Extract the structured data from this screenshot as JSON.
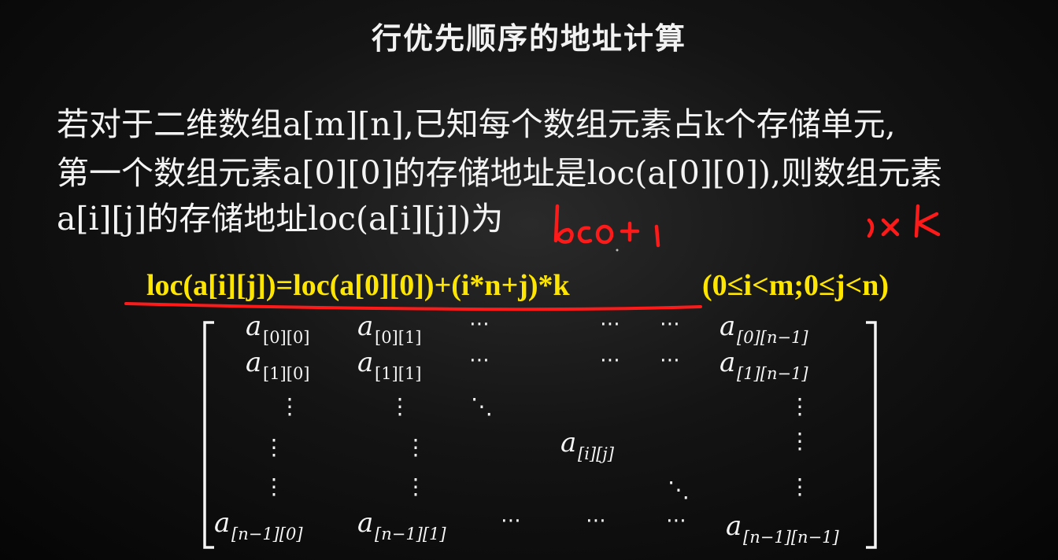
{
  "slide": {
    "title": "行优先顺序的地址计算",
    "paragraph": [
      "若对于二维数组a[m][n],已知每个数组元素占k个存储单元,",
      "第一个数组元素a[0][0]的存储地址是loc(a[0][0]),则数组元素",
      "a[i][j]的存储地址loc(a[i][j])为"
    ],
    "formula": "loc(a[i][j])=loc(a[0][0])+(i*n+j)*k",
    "condition": "(0≤i<m;0≤j<n)",
    "handwriting": {
      "note_left": "loco + i",
      "note_right": "j×k",
      "color": "#ff1a1a"
    },
    "formula_color": "#ffe600"
  },
  "matrix": {
    "base": "a",
    "rows": [
      [
        "[0][0]",
        "[0][1]",
        "⋯",
        "⋯",
        "⋯",
        "[0][n−1]"
      ],
      [
        "[1][0]",
        "[1][1]",
        "⋯",
        "⋯",
        "⋯",
        "[1][n−1]"
      ],
      [
        "⋮",
        "⋮",
        "⋱",
        "⋮"
      ],
      [
        "⋮",
        "⋮",
        "[i][j]",
        "⋮"
      ],
      [
        "⋮",
        "⋮",
        "⋱",
        "⋮"
      ],
      [
        "[n−1][0]",
        "[n−1][1]",
        "⋯",
        "⋯",
        "⋯",
        "[n−1][n−1]"
      ]
    ]
  }
}
